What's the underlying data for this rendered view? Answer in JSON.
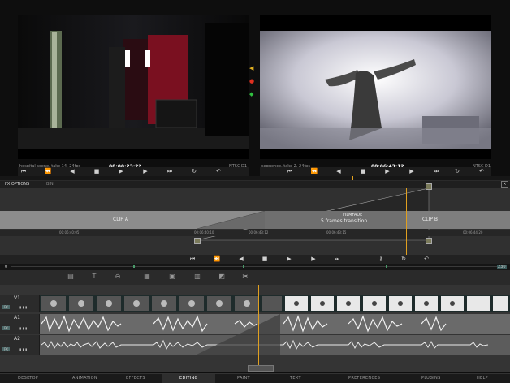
{
  "viewers": {
    "left": {
      "info": "hospital scene, take 14, 24fps",
      "timecode": "00:00:23:22",
      "format": "NTSC D1"
    },
    "right": {
      "info": "sequence, take 2, 24fps",
      "timecode": "00:06:43:12",
      "format": "NTSC D1"
    }
  },
  "fx": {
    "options_label": "FX OPTIONS",
    "bin_label": "BIN"
  },
  "clips": {
    "a": "CLIP A",
    "transition_name": "FILMFADE",
    "transition_length": "5 frames transition",
    "b": "CLIP B"
  },
  "ruler": [
    "00:06:40:05",
    "00:06:40:10",
    "00:06:43:12",
    "00:06:43:15",
    "00:06:44:20"
  ],
  "scrub": {
    "start": "0",
    "end": "230"
  },
  "tracks": [
    {
      "name": "V1",
      "badge": "FX"
    },
    {
      "name": "A1",
      "badge": "FX"
    },
    {
      "name": "A2",
      "badge": "FX"
    }
  ],
  "nav": [
    "DESKTOP",
    "ANIMATION",
    "EFFECTS",
    "EDITING",
    "PAINT",
    "TEXT",
    "PREFERENCES",
    "PLUGINS",
    "HELP"
  ],
  "nav_active": "EDITING",
  "colors": {
    "playhead": "#e0a020",
    "accent": "#5a8a8a"
  }
}
